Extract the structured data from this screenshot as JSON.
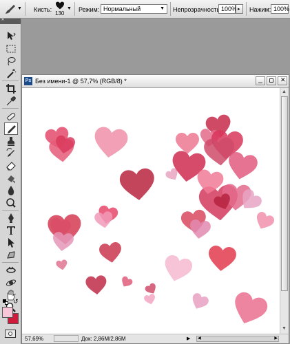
{
  "options_bar": {
    "brushes_label": "Кисть:",
    "brush_size": "130",
    "mode_label": "Режим:",
    "mode_value": "Нормальный",
    "opacity_label": "Непрозрачность:",
    "opacity_value": "100%",
    "pressure_label": "Нажим:",
    "pressure_value": "100%"
  },
  "colors": {
    "foreground": "#f7c6d8",
    "background": "#d01a3c"
  },
  "document": {
    "title": "Без имени-1 @ 57,7% (RGB/8) *",
    "zoom": "57,69%",
    "doc_info": "Док: 2,86M/2,86M"
  },
  "toolbox": {
    "tools": [
      "move-icon",
      "marquee-icon",
      "lasso-icon",
      "magic-wand-icon",
      "crop-icon",
      "eyedropper-icon",
      "healing-brush-icon",
      "brush-icon",
      "stamp-icon",
      "history-brush-icon",
      "eraser-icon",
      "gradient-icon",
      "blur-icon",
      "dodge-icon",
      "pen-icon",
      "type-icon",
      "path-select-icon",
      "shape-icon",
      "3d-rotate-icon",
      "3d-orbit-icon",
      "hand-icon",
      "zoom-icon"
    ]
  },
  "hearts": [
    {
      "color": "#e34a6a",
      "op": 0.85
    },
    {
      "color": "#e55a78",
      "op": 0.85
    },
    {
      "color": "#d93a5c",
      "op": 0.85
    },
    {
      "color": "#f08fa8",
      "op": 0.85
    },
    {
      "color": "#ec7892",
      "op": 0.85
    },
    {
      "color": "#c72c4a",
      "op": 0.85
    },
    {
      "color": "#e36a8a",
      "op": 0.85
    },
    {
      "color": "#d8365a",
      "op": 0.85
    },
    {
      "color": "#b8243e",
      "op": 0.85
    },
    {
      "color": "#e8a4c0",
      "op": 0.85
    },
    {
      "color": "#d02c50",
      "op": 0.85
    },
    {
      "color": "#cf4a6a",
      "op": 0.85
    },
    {
      "color": "#e05a7e",
      "op": 0.85
    },
    {
      "color": "#d23a5c",
      "op": 0.85
    },
    {
      "color": "#f07a96",
      "op": 0.85
    },
    {
      "color": "#e36a8c",
      "op": 0.85
    },
    {
      "color": "#e8a4c4",
      "op": 0.85
    },
    {
      "color": "#b5233f",
      "op": 0.85
    },
    {
      "color": "#f091ab",
      "op": 0.85
    },
    {
      "color": "#d8485e",
      "op": 0.85
    },
    {
      "color": "#e28ab0",
      "op": 0.85
    },
    {
      "color": "#f4b6d2",
      "op": 0.85
    },
    {
      "color": "#d53a52",
      "op": 0.85
    },
    {
      "color": "#e8466a",
      "op": 0.85
    },
    {
      "color": "#f19ab8",
      "op": 0.85
    },
    {
      "color": "#c9364e",
      "op": 0.85
    },
    {
      "color": "#e07492",
      "op": 0.85
    },
    {
      "color": "#e596b8",
      "op": 0.85
    },
    {
      "color": "#e23a4e",
      "op": 0.85
    },
    {
      "color": "#f4b8d0",
      "op": 0.85
    },
    {
      "color": "#c02c48",
      "op": 0.85
    },
    {
      "color": "#e05c7a",
      "op": 0.85
    },
    {
      "color": "#f3a4c2",
      "op": 0.85
    },
    {
      "color": "#d04b6a",
      "op": 0.85
    },
    {
      "color": "#e8a0c2",
      "op": 0.85
    },
    {
      "color": "#ea7090",
      "op": 0.85
    }
  ]
}
